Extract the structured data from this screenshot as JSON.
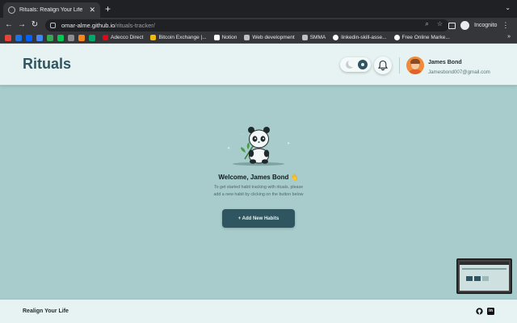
{
  "browser": {
    "tab_title": "Rituals: Realign Your Life",
    "url_host": "omar-alme.github.io",
    "url_path": "/rituals-tracker/",
    "incognito_label": "Incognito",
    "bookmarks": [
      {
        "label": "Adecco Direct",
        "icon": "adecco-icon"
      },
      {
        "label": "Bitcoin Exchange |...",
        "icon": "binance-icon"
      },
      {
        "label": "Notion",
        "icon": "notion-icon"
      },
      {
        "label": "Web development",
        "icon": "folder-icon"
      },
      {
        "label": "SMMA",
        "icon": "folder-icon"
      },
      {
        "label": "linkedin-skill-asse...",
        "icon": "github-icon"
      },
      {
        "label": "Free Online Marke...",
        "icon": "google-icon"
      }
    ],
    "more_bookmarks": "»"
  },
  "header": {
    "brand": "Rituals",
    "user_name": "James Bond",
    "user_email": "Jamesbond007@gmail.com"
  },
  "empty_state": {
    "welcome": "Welcome, James Bond",
    "wave_emoji": "👋",
    "hint": "To get started habit tracking with rituals, please add a new habit by clicking on the button below",
    "add_button": "+ Add New Habits"
  },
  "footer": {
    "tagline": "Realign Your Life"
  },
  "colors": {
    "brand": "#2f5560",
    "background": "#a8cccc",
    "header_bg": "#e6f3f2"
  }
}
